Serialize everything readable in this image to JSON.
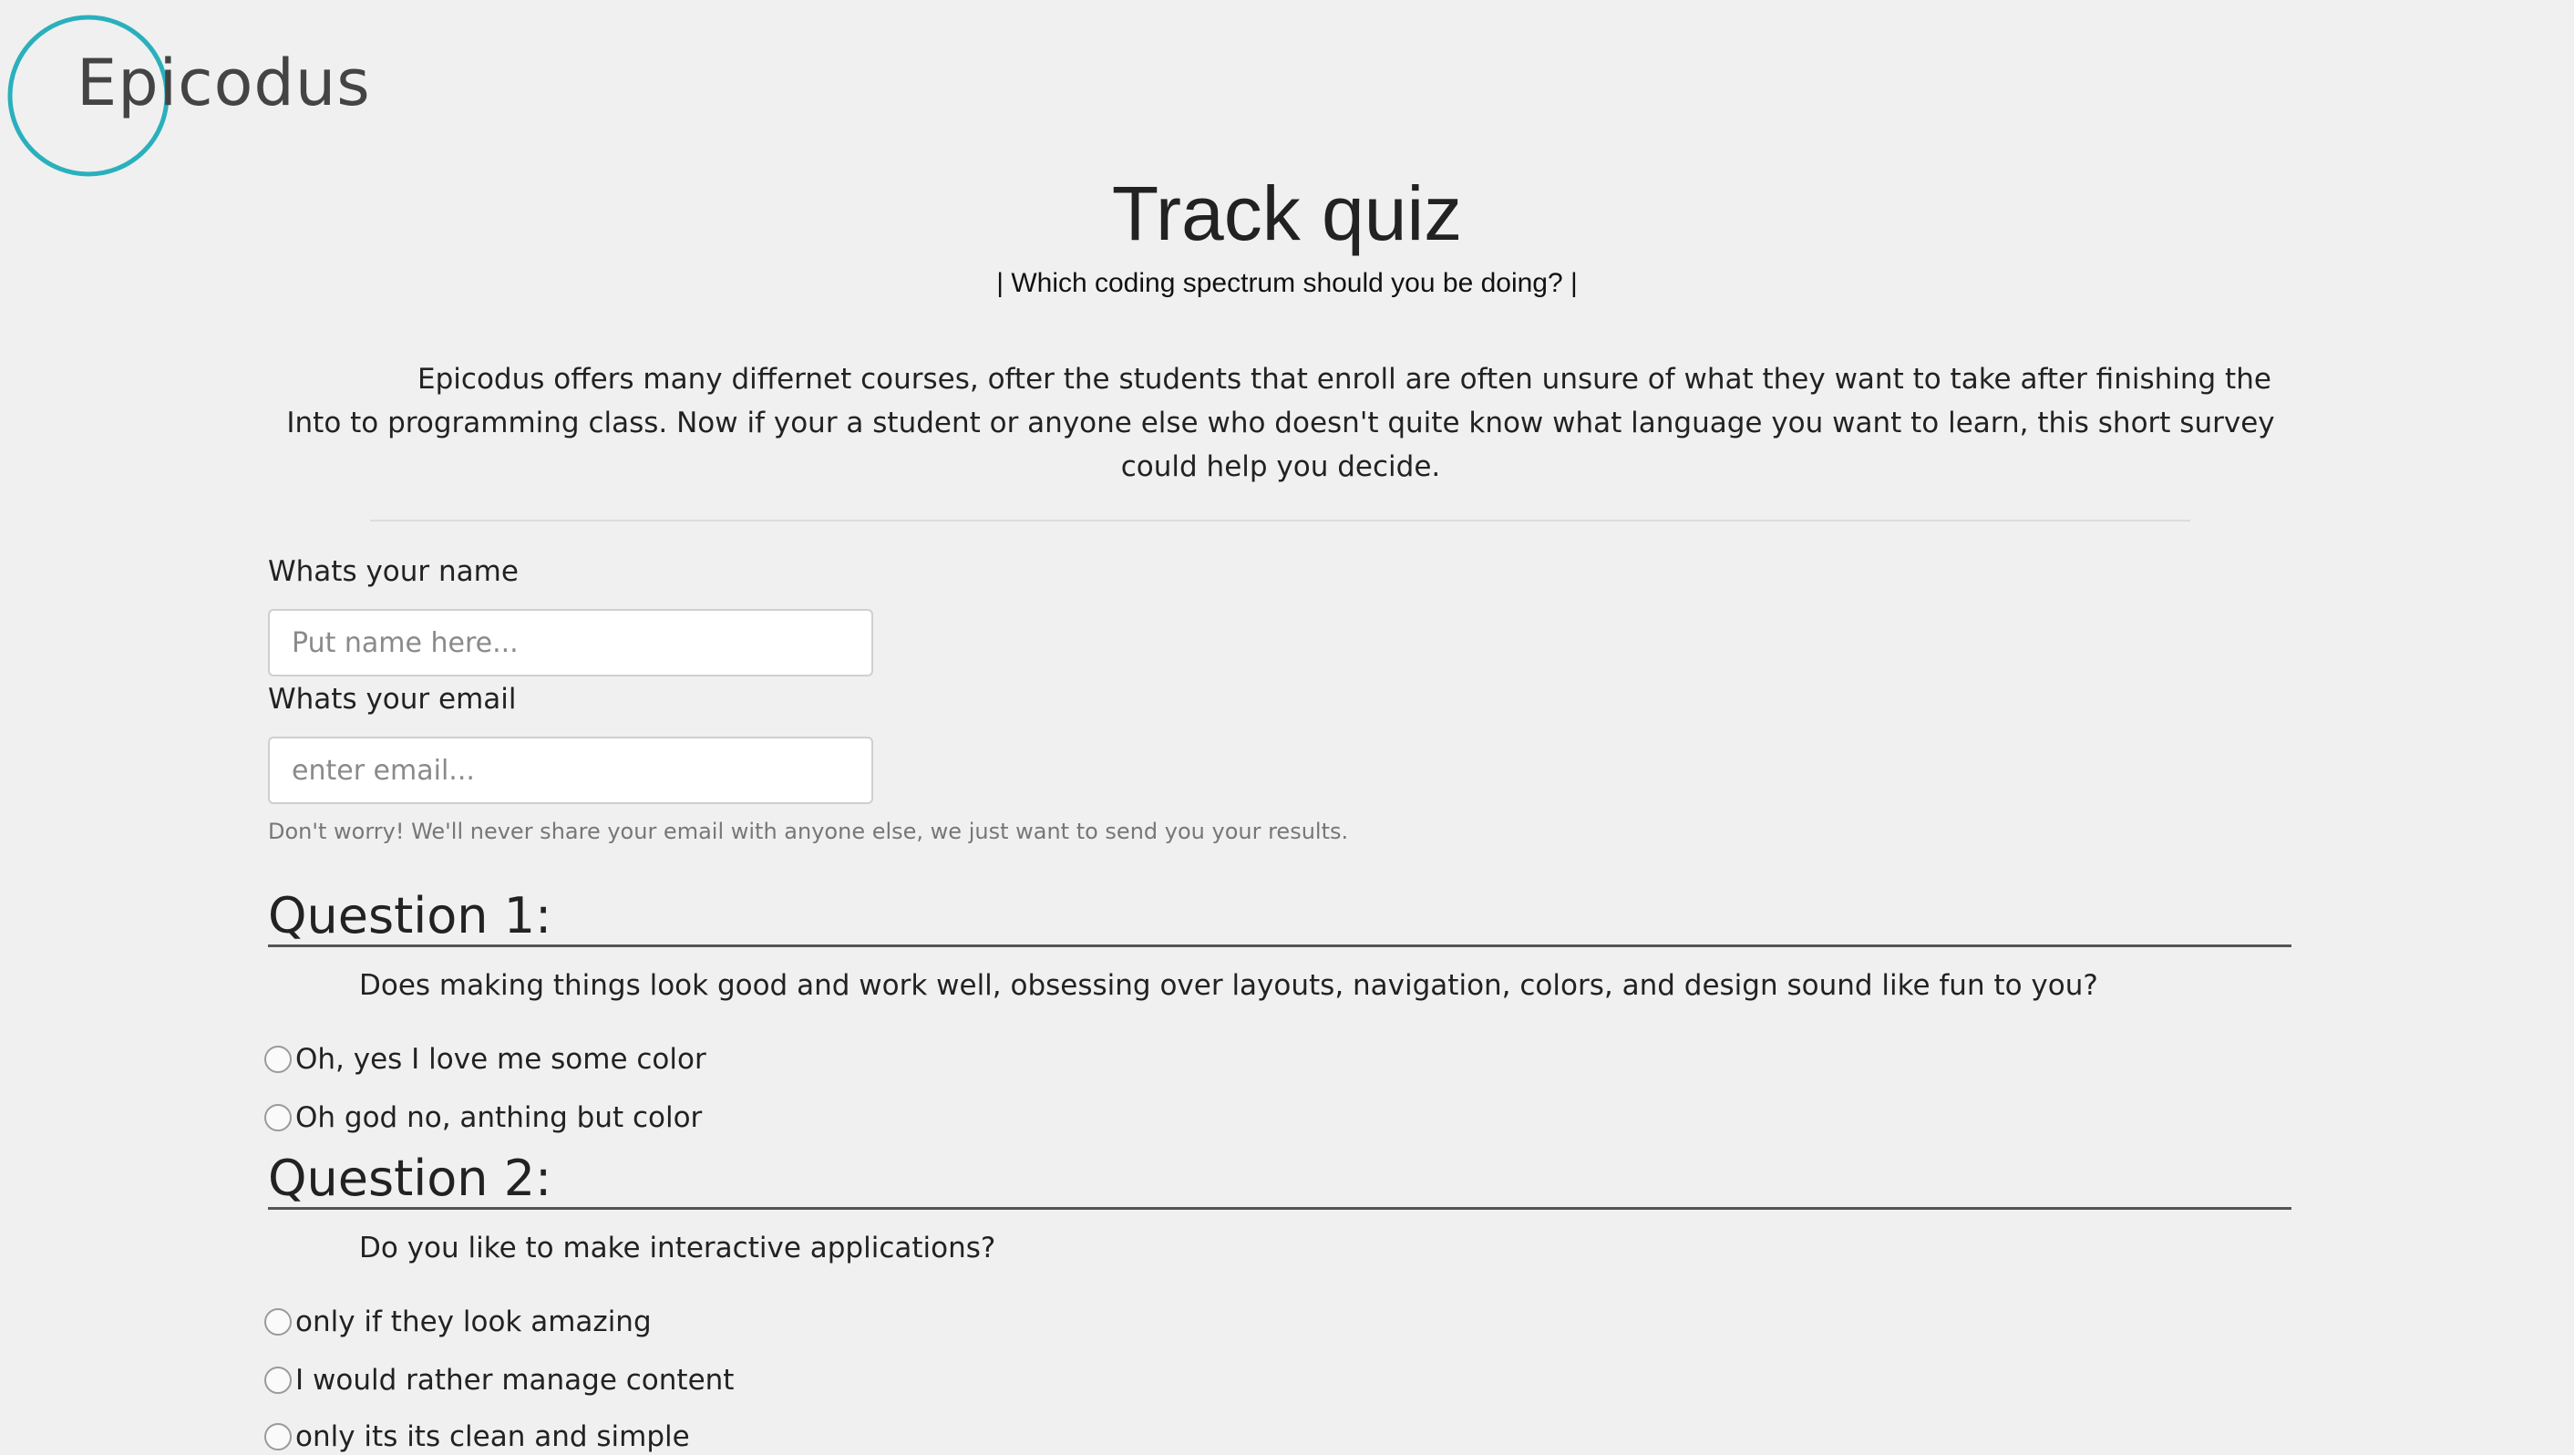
{
  "logo": {
    "text": "Epicodus",
    "ring_color": "#2ab0bc"
  },
  "header": {
    "title": "Track quiz",
    "subtitle": "| Which coding spectrum should you be doing? |"
  },
  "intro": {
    "text": "Epicodus offers many differnet courses, ofter the students that enroll are often unsure of what they want to take after finishing the Into to programming class. Now if your a student or anyone else who doesn't quite know what language you want to learn, this short survey could help you decide."
  },
  "form": {
    "name_label": "Whats your name",
    "name_placeholder": "Put name here...",
    "email_label": "Whats your email",
    "email_placeholder": "enter email...",
    "email_help": "Don't worry! We'll never share your email with anyone else, we just want to send you your results."
  },
  "questions": [
    {
      "heading": "Question 1:",
      "text": "Does making things look good and work well, obsessing over layouts, navigation, colors, and design sound like fun to you?",
      "options": [
        "Oh, yes I love me some color",
        "Oh god no, anthing but color"
      ]
    },
    {
      "heading": "Question 2:",
      "text": "Do you like to make interactive applications?",
      "options": [
        "only if they look amazing",
        "I would rather manage content",
        "only its its clean and simple"
      ]
    }
  ]
}
